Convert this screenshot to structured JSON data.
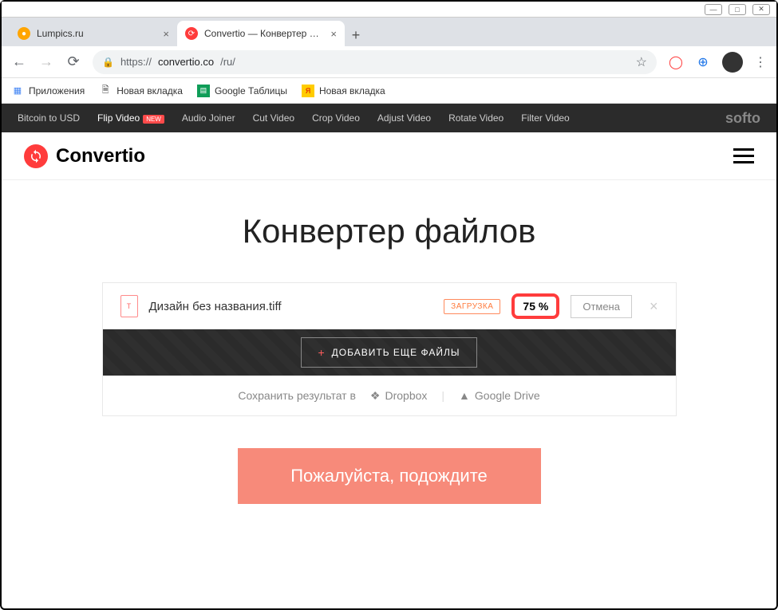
{
  "window": {
    "tabs": [
      {
        "title": "Lumpics.ru",
        "active": false
      },
      {
        "title": "Convertio — Конвертер файлов",
        "active": true
      }
    ]
  },
  "browser": {
    "url_scheme": "https://",
    "url_host": "convertio.co",
    "url_path": "/ru/",
    "bookmarks": [
      {
        "icon": "apps",
        "label": "Приложения"
      },
      {
        "icon": "doc",
        "label": "Новая вкладка"
      },
      {
        "icon": "sheets",
        "label": "Google Таблицы"
      },
      {
        "icon": "yandex",
        "label": "Новая вкладка"
      }
    ]
  },
  "softo": {
    "items": [
      {
        "label": "Bitcoin to USD",
        "new": false
      },
      {
        "label": "Flip Video",
        "new": true
      },
      {
        "label": "Audio Joiner",
        "new": false
      },
      {
        "label": "Cut Video",
        "new": false
      },
      {
        "label": "Crop Video",
        "new": false
      },
      {
        "label": "Adjust Video",
        "new": false
      },
      {
        "label": "Rotate Video",
        "new": false
      },
      {
        "label": "Filter Video",
        "new": false
      }
    ],
    "new_label": "NEW",
    "brand": "softo"
  },
  "convertio": {
    "brand": "Convertio",
    "page_title": "Конвертер файлов",
    "file": {
      "name": "Дизайн без названия.tiff",
      "status_label": "ЗАГРУЗКА",
      "progress": "75 %",
      "cancel_label": "Отмена"
    },
    "add_more_label": "ДОБАВИТЬ ЕЩЕ ФАЙЛЫ",
    "save_label": "Сохранить результат в",
    "save_options": [
      {
        "icon": "dropbox",
        "label": "Dropbox"
      },
      {
        "icon": "gdrive",
        "label": "Google Drive"
      }
    ],
    "wait_label": "Пожалуйста, подождите"
  }
}
